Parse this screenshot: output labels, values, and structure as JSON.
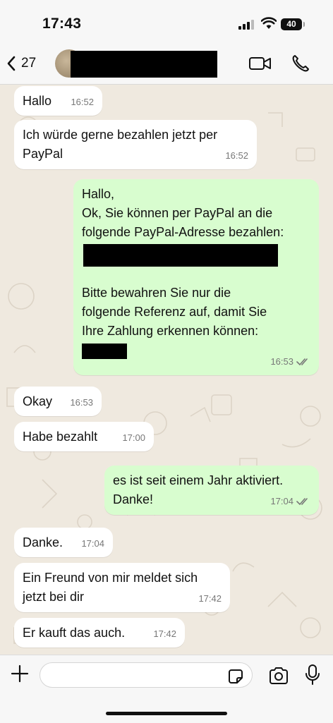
{
  "status_bar": {
    "time": "17:43",
    "battery": "40"
  },
  "header": {
    "back_count": "27"
  },
  "messages": [
    {
      "dir": "in",
      "text": "Hallo",
      "time": "16:52"
    },
    {
      "dir": "in",
      "text": "Ich würde gerne bezahlen jetzt per\nPayPal",
      "time": "16:52"
    },
    {
      "dir": "out",
      "lines": [
        "Hallo,",
        "Ok, Sie können per PayPal an die",
        "folgende PayPal-Adresse bezahlen:"
      ],
      "lines2": [
        "Bitte bewahren Sie nur die",
        "folgende Referenz auf, damit Sie",
        "Ihre Zahlung erkennen können:"
      ],
      "time": "16:53",
      "read": true
    },
    {
      "dir": "in",
      "text": "Okay",
      "time": "16:53"
    },
    {
      "dir": "in",
      "text": "Habe bezahlt",
      "time": "17:00"
    },
    {
      "dir": "out",
      "text": "es ist seit einem Jahr aktiviert.\nDanke!",
      "time": "17:04",
      "read": true
    },
    {
      "dir": "in",
      "text": "Danke.",
      "time": "17:04"
    },
    {
      "dir": "in",
      "text": "Ein Freund von mir meldet sich\njetzt bei dir",
      "time": "17:42"
    },
    {
      "dir": "in",
      "text": "Er kauft das auch.",
      "time": "17:42"
    }
  ],
  "composer": {
    "placeholder": ""
  },
  "colors": {
    "incoming": "#ffffff",
    "outgoing": "#d8fdcf",
    "background": "#efe9df"
  }
}
